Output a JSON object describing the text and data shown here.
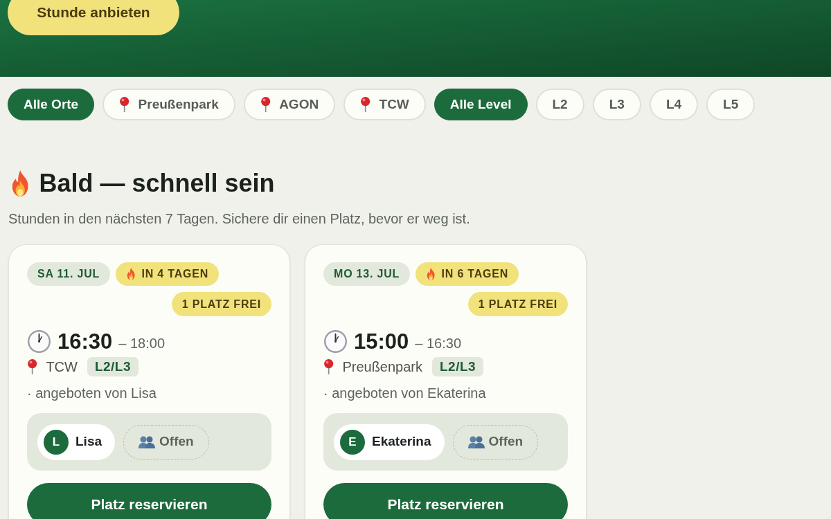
{
  "header": {
    "button": "Stunde anbieten"
  },
  "filters": {
    "locations": [
      {
        "label": "Alle Orte",
        "kind": "all",
        "selected": true
      },
      {
        "label": "Preußenpark",
        "kind": "place",
        "selected": false
      },
      {
        "label": "AGON",
        "kind": "place",
        "selected": false
      },
      {
        "label": "TCW",
        "kind": "place",
        "selected": false
      }
    ],
    "levels": [
      {
        "label": "Alle Level",
        "selected": true
      },
      {
        "label": "L2",
        "selected": false
      },
      {
        "label": "L3",
        "selected": false
      },
      {
        "label": "L4",
        "selected": false
      },
      {
        "label": "L5",
        "selected": false
      }
    ]
  },
  "section": {
    "title": "Bald — schnell sein",
    "subtitle": "Stunden in den nächsten 7 Tagen. Sichere dir einen Platz, bevor er weg ist."
  },
  "lessons": [
    {
      "date": "SA 11. JUL",
      "countdown": "IN 4 TAGEN",
      "spots": "1 PLATZ FREI",
      "start": "16:30",
      "end": "– 18:00",
      "place": "TCW",
      "level": "L2/L3",
      "offered_by": "· angeboten von Lisa",
      "participants": [
        {
          "kind": "person",
          "initial": "L",
          "name": "Lisa"
        },
        {
          "kind": "open",
          "label": "Offen"
        }
      ],
      "button": "Platz reservieren"
    },
    {
      "date": "MO 13. JUL",
      "countdown": "IN 6 TAGEN",
      "spots": "1 PLATZ FREI",
      "start": "15:00",
      "end": "– 16:30",
      "place": "Preußenpark",
      "level": "L2/L3",
      "offered_by": "· angeboten von Ekaterina",
      "participants": [
        {
          "kind": "person",
          "initial": "E",
          "name": "Ekaterina"
        },
        {
          "kind": "open",
          "label": "Offen"
        }
      ],
      "button": "Platz reservieren"
    }
  ]
}
